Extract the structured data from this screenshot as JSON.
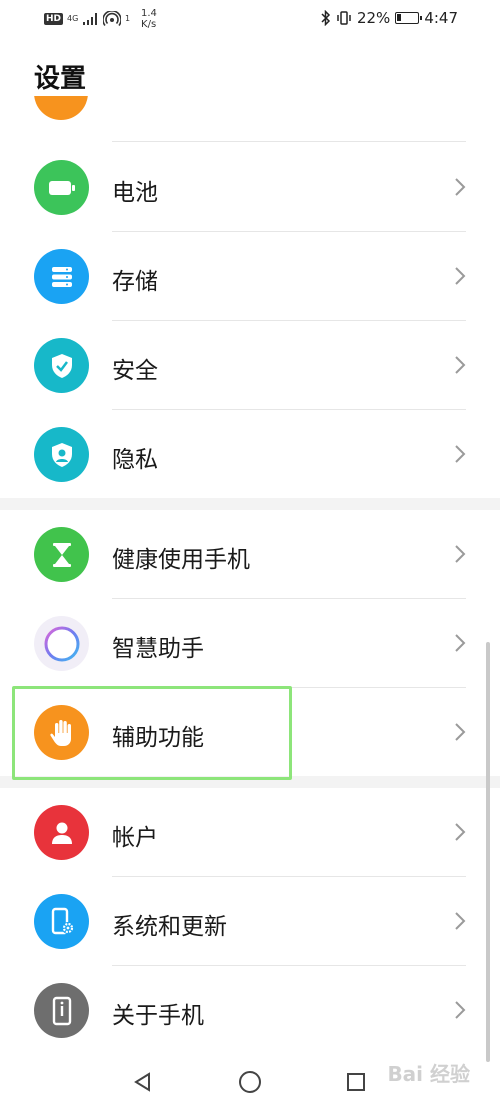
{
  "status_bar": {
    "hd": "HD",
    "network": "4G",
    "signal_bars": "1",
    "speed_value": "1.4",
    "speed_unit": "K/s",
    "battery_percent_text": "22%",
    "battery_level": 0.22,
    "time": "4:47"
  },
  "page_title": "设置",
  "colors": {
    "battery_green": "#3cc45a",
    "storage_blue": "#1aa3f3",
    "security_teal": "#17b8c9",
    "privacy_teal": "#17b8c9",
    "health_green": "#41c34c",
    "accessibility_orange": "#f7931e",
    "account_red": "#e8333b",
    "system_blue": "#1aa3f3",
    "about_gray": "#6e6e6e",
    "highlight_green": "#8de57a"
  },
  "items": [
    {
      "label": "电池",
      "icon": "battery-icon"
    },
    {
      "label": "存储",
      "icon": "storage-icon"
    },
    {
      "label": "安全",
      "icon": "shield-check-icon"
    },
    {
      "label": "隐私",
      "icon": "privacy-shield-icon"
    },
    {
      "label": "健康使用手机",
      "icon": "hourglass-icon"
    },
    {
      "label": "智慧助手",
      "icon": "assistant-ring-icon"
    },
    {
      "label": "辅助功能",
      "icon": "hand-icon"
    },
    {
      "label": "帐户",
      "icon": "person-icon"
    },
    {
      "label": "系统和更新",
      "icon": "phone-gear-icon"
    },
    {
      "label": "关于手机",
      "icon": "phone-info-icon"
    }
  ],
  "watermark": "Bai 经验"
}
